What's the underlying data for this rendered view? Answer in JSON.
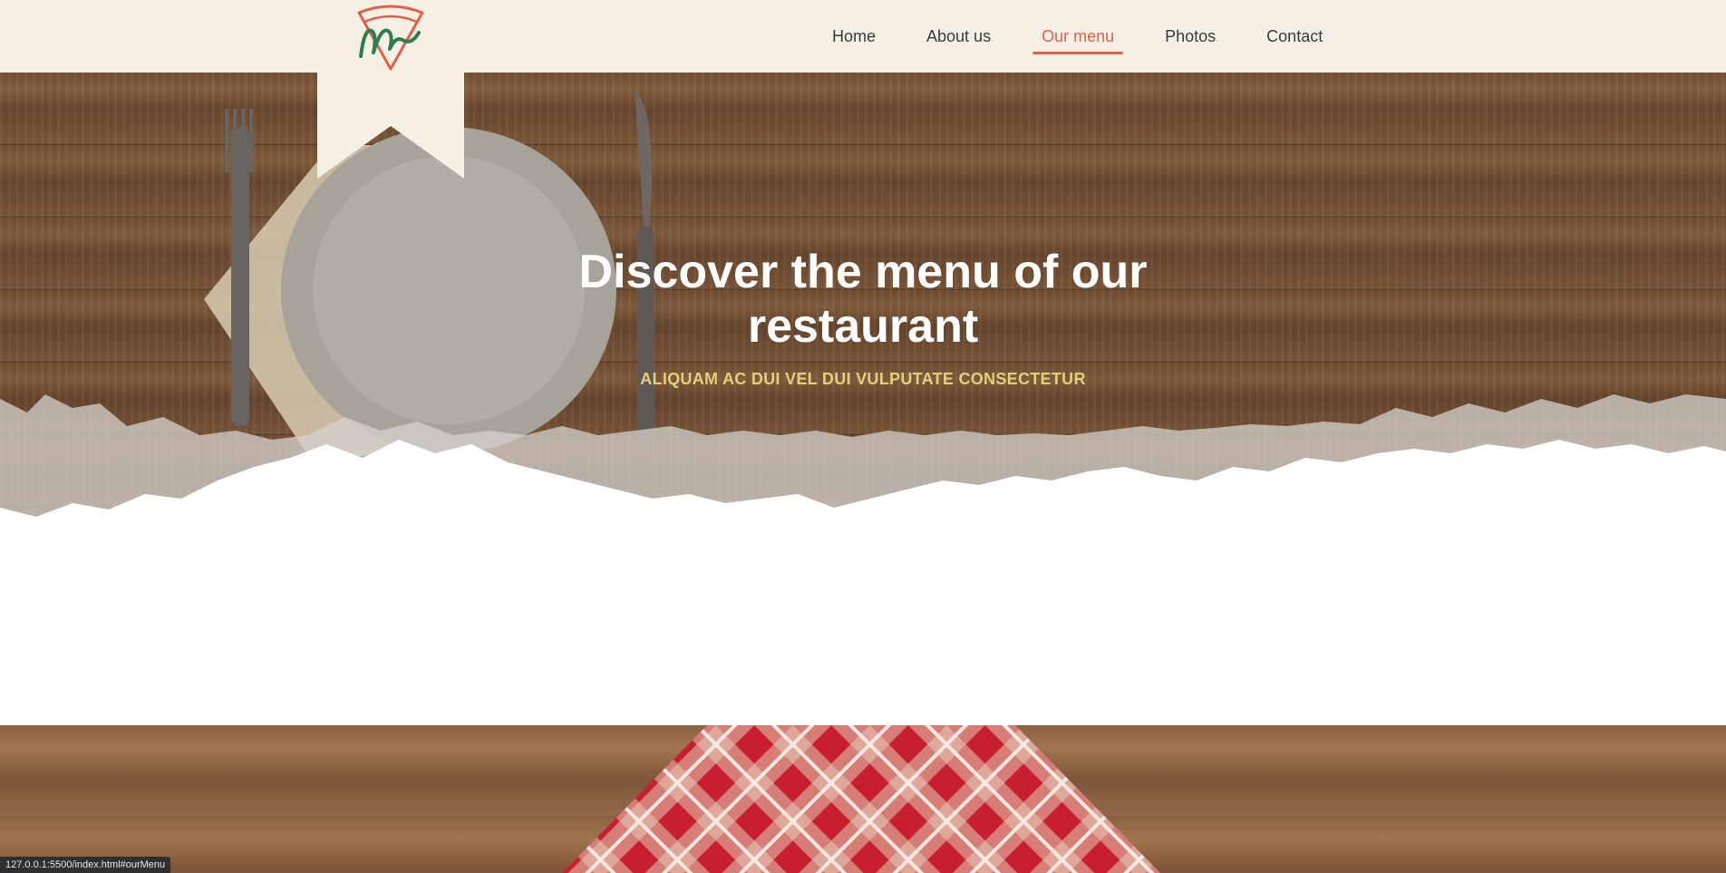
{
  "nav": {
    "items": [
      {
        "label": "Home",
        "active": false
      },
      {
        "label": "About us",
        "active": false
      },
      {
        "label": "Our menu",
        "active": true
      },
      {
        "label": "Photos",
        "active": false
      },
      {
        "label": "Contact",
        "active": false
      }
    ]
  },
  "hero": {
    "title": "Discover the menu of our restaurant",
    "subtitle": "ALIQUAM AC DUI VEL DUI VULPUTATE CONSECTETUR"
  },
  "status_bar": {
    "url": "127.0.0.1:5500/index.html#ourMenu"
  },
  "colors": {
    "topbar_bg": "#f6efe4",
    "accent": "#e0604a",
    "nav_text": "#3b3b3b",
    "subtitle": "#e4cf7c",
    "logo_green": "#2e7d4f"
  }
}
